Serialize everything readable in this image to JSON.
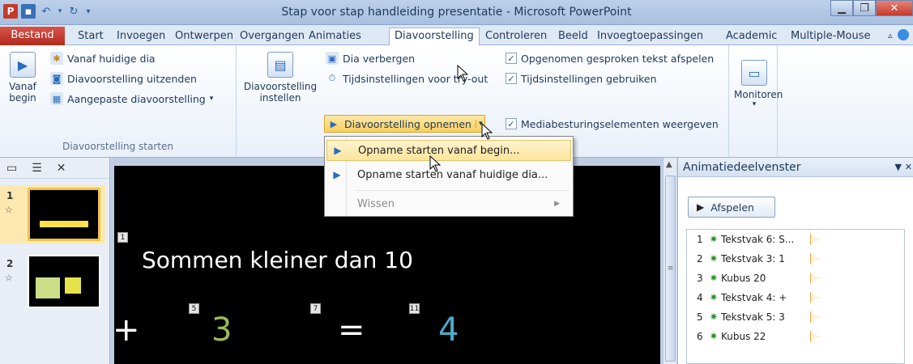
{
  "window": {
    "title": "Stap voor stap handleiding presentatie - Microsoft PowerPoint"
  },
  "tabs": [
    {
      "label": "Bestand"
    },
    {
      "label": "Start"
    },
    {
      "label": "Invoegen"
    },
    {
      "label": "Ontwerpen"
    },
    {
      "label": "Overgangen"
    },
    {
      "label": "Animaties"
    },
    {
      "label": "Diavoorstelling"
    },
    {
      "label": "Controleren"
    },
    {
      "label": "Beeld"
    },
    {
      "label": "Invoegtoepassingen"
    },
    {
      "label": "Academic"
    },
    {
      "label": "Multiple-Mouse"
    }
  ],
  "ribbon": {
    "group1": {
      "label": "Diavoorstelling starten",
      "vanaf_begin": "Vanaf\nbegin",
      "vanaf_begin_l1": "Vanaf",
      "vanaf_begin_l2": "begin",
      "vanaf_huidige": "Vanaf huidige dia",
      "uitzenden": "Diavoorstelling uitzenden",
      "aangepaste": "Aangepaste diavoorstelling"
    },
    "group2": {
      "instellen_l1": "Diavoorstelling",
      "instellen_l2": "instellen",
      "verbergen": "Dia verbergen",
      "tijdsinstellingen": "Tijdsinstellingen voor try-out",
      "opnemen": "Diavoorstelling opnemen",
      "opgenomen": "Opgenomen gesproken tekst afspelen",
      "tijd_gebruiken": "Tijdsinstellingen gebruiken",
      "media": "Mediabesturingselementen weergeven"
    },
    "group3": {
      "monitoren": "Monitoren"
    }
  },
  "dropdown": {
    "items": [
      {
        "label": "Opname starten vanaf begin..."
      },
      {
        "label": "Opname starten vanaf huidige dia..."
      },
      {
        "label": "Wissen"
      }
    ]
  },
  "slides": [
    {
      "number": "1"
    },
    {
      "number": "2"
    }
  ],
  "slide": {
    "title": "Sommen kleiner dan 10",
    "tags": [
      "1",
      "5",
      "7",
      "11"
    ],
    "plus": "+",
    "num3": "3",
    "equals": "=",
    "num4": "4",
    "colors": {
      "num3": "#9bbb59",
      "num4": "#4bacc6",
      "text": "#ffffff"
    }
  },
  "animation_pane": {
    "title": "Animatiedeelvenster",
    "play": "Afspelen",
    "items": [
      {
        "n": "1",
        "label": "Tekstvak 6: S..."
      },
      {
        "n": "2",
        "label": "Tekstvak 3: 1"
      },
      {
        "n": "3",
        "label": "Kubus 20"
      },
      {
        "n": "4",
        "label": "Tekstvak 4: +"
      },
      {
        "n": "5",
        "label": "Tekstvak 5: 3"
      },
      {
        "n": "6",
        "label": "Kubus 22"
      }
    ]
  }
}
